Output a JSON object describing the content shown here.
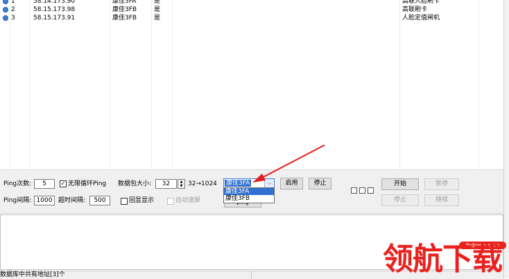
{
  "device_list": {
    "rows": [
      {
        "index": "1",
        "ip": "58.14.173.90",
        "brand": "康佳3FA",
        "status": "是",
        "type": "高联人脸刷卡"
      },
      {
        "index": "2",
        "ip": "58.15.173.98",
        "brand": "康佳3FB",
        "status": "是",
        "type": "高联刷卡"
      },
      {
        "index": "3",
        "ip": "58.15.173.91",
        "brand": "康佳3FB",
        "status": "是",
        "type": "人脸定值闸机"
      }
    ]
  },
  "controls": {
    "ping_count_label": "Ping次数:",
    "ping_count": "5",
    "infinite_loop_label": "无限循环Ping",
    "packet_size_label": "数据包大小:",
    "packet_size": "32",
    "packet_range": "32→1024",
    "ping_interval_label": "Ping间隔:",
    "ping_interval": "1000",
    "timeout_label": "超时间隔:",
    "timeout": "500",
    "echo_label": "回显显示",
    "autoscroll_label": "自动滚屏",
    "brand_selected": "康佳3FA",
    "brand_options": [
      "康佳3FA",
      "康佳3FB"
    ],
    "partial_button": "---ping---",
    "enable_button": "启用",
    "stop_button_a": "停止",
    "start_button": "开始",
    "pause_button": "暂停",
    "stop_button_b": "停止",
    "continue_button": "继续"
  },
  "status_bar": {
    "text": "数据库中共有地址[3]个"
  },
  "watermark": {
    "brand": "领航下载",
    "url": "lhdown.com"
  }
}
